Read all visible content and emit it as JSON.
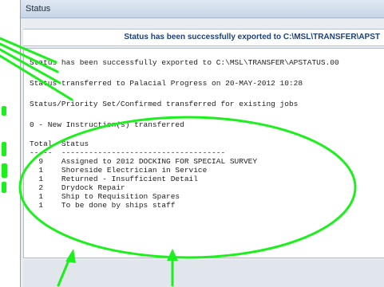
{
  "window": {
    "title": "Status"
  },
  "banner": {
    "message": "Status has been successfully exported to C:\\MSL\\TRANSFER\\APST"
  },
  "log": {
    "lines": [
      "Status has been successfully exported to C:\\MSL\\TRANSFER\\APSTATUS.00",
      "Status transferred to Palacial Progress on 20-MAY-2012 10:28",
      "Status/Priority Set/Confirmed transferred for existing jobs",
      "0 - New Instruction(s) transferred",
      "Total  Status",
      "-----  ------------------------------------",
      "  9    Assigned to 2012 DOCKING FOR SPECIAL SURVEY",
      "  1    Shoreside Electrician in Service",
      "  1    Returned - Insufficient Detail",
      "  2    Drydock Repair",
      "  1    Ship to Requisition Spares",
      "  1    To be done by ships staff"
    ]
  },
  "colors": {
    "annotation": "#1cf01c",
    "banner_text": "#1d3f7a",
    "left_text": "#1cf01c"
  }
}
